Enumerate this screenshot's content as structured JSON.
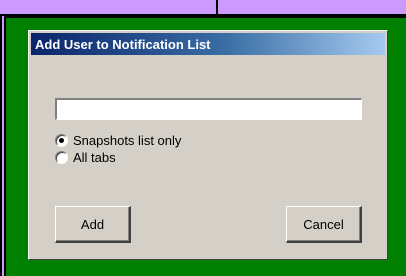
{
  "dialog": {
    "title": "Add User to Notification List",
    "input": {
      "value": "",
      "placeholder": ""
    },
    "options": [
      {
        "label": "Snapshots list only",
        "selected": true
      },
      {
        "label": "All tabs",
        "selected": false
      }
    ],
    "buttons": {
      "add_label": "Add",
      "cancel_label": "Cancel"
    }
  },
  "colors": {
    "outer_background": "#cc99ff",
    "frame_green": "#008000",
    "dialog_face": "#d4d0c8",
    "title_bar_start": "#0a246a",
    "title_bar_end": "#a6caf0"
  }
}
